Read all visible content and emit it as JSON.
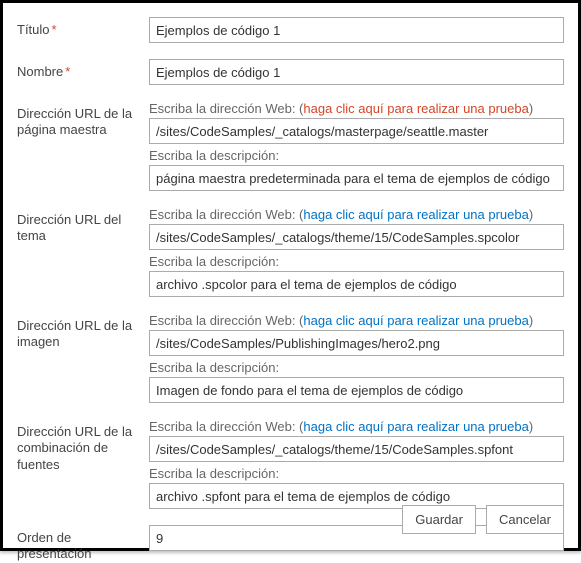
{
  "labels": {
    "title": "Título",
    "name": "Nombre",
    "masterUrl": "Dirección URL de la página maestra",
    "themeUrl": "Dirección URL del tema",
    "imageUrl": "Dirección URL de la imagen",
    "fontUrl": "Dirección URL de la combinación de fuentes",
    "order": "Orden de presentación"
  },
  "sublabels": {
    "webPrefix": "Escriba la dirección Web: (",
    "webSuffix": ")",
    "testLink": "haga clic aquí para realizar una prueba",
    "desc": "Escriba la descripción:"
  },
  "values": {
    "title": "Ejemplos de código 1",
    "name": "Ejemplos de código 1",
    "masterUrl": "/sites/CodeSamples/_catalogs/masterpage/seattle.master",
    "masterDesc": "página maestra predeterminada para el tema de ejemplos de código",
    "themeUrl": "/sites/CodeSamples/_catalogs/theme/15/CodeSamples.spcolor",
    "themeDesc": "archivo .spcolor para el tema de ejemplos de código",
    "imageUrl": "/sites/CodeSamples/PublishingImages/hero2.png",
    "imageDesc": "Imagen de fondo para el tema de ejemplos de código",
    "fontUrl": "/sites/CodeSamples/_catalogs/theme/15/CodeSamples.spfont",
    "fontDesc": "archivo .spfont para el tema de ejemplos de código",
    "order": "9"
  },
  "buttons": {
    "save": "Guardar",
    "cancel": "Cancelar"
  }
}
